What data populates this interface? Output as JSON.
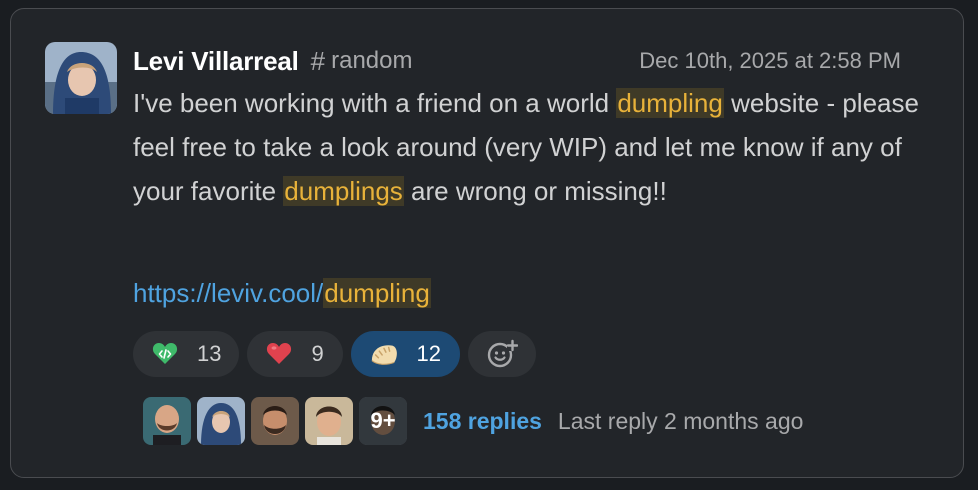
{
  "message": {
    "author": "Levi Villarreal",
    "channel_hash": "#",
    "channel": "random",
    "timestamp": "Dec 10th, 2025 at 2:58 PM",
    "text_parts": {
      "p1": "I've been working with a friend on a world ",
      "h1": "dumpling",
      "p2": " website - please feel free to take a look around (very WIP) and let me know if any of your favorite ",
      "h2": "dumplings",
      "p3": " are wrong or missing!!"
    },
    "link": {
      "prefix": "https://leviv.cool/",
      "highlight": "dumpling"
    }
  },
  "reactions": [
    {
      "icon": "green-code-heart-icon",
      "count": "13",
      "active": false
    },
    {
      "icon": "red-heart-icon",
      "count": "9",
      "active": false
    },
    {
      "icon": "dumpling-icon",
      "count": "12",
      "active": true
    }
  ],
  "add_reaction_icon": "add-emoji-icon",
  "thread": {
    "more_label": "9+",
    "replies": "158 replies",
    "last_reply": "Last reply 2 months ago"
  },
  "colors": {
    "background": "#222529",
    "highlight_text": "#e8b23a",
    "link": "#4fa3e0",
    "active_reaction": "#1d4a74"
  }
}
